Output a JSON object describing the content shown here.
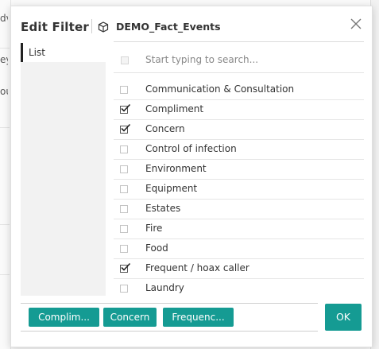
{
  "dialog": {
    "title": "Edit Filter",
    "table_name": "DEMO_Fact_Events",
    "ok_label": "OK"
  },
  "nav": {
    "items": [
      {
        "label": "List",
        "active": true
      }
    ]
  },
  "search": {
    "placeholder": "Start typing to search..."
  },
  "items": [
    {
      "label": "Communication & Consultation",
      "checked": false
    },
    {
      "label": "Compliment",
      "checked": true
    },
    {
      "label": "Concern",
      "checked": true
    },
    {
      "label": "Control of infection",
      "checked": false
    },
    {
      "label": "Environment",
      "checked": false
    },
    {
      "label": "Equipment",
      "checked": false
    },
    {
      "label": "Estates",
      "checked": false
    },
    {
      "label": "Fire",
      "checked": false
    },
    {
      "label": "Food",
      "checked": false
    },
    {
      "label": "Frequent / hoax caller",
      "checked": true
    },
    {
      "label": "Laundry",
      "checked": false
    }
  ],
  "selected_chips": [
    "Complim...",
    "Concern",
    "Frequenc..."
  ],
  "background_fragments": [
    "dv",
    "ey",
    "ou"
  ],
  "colors": {
    "accent": "#159b93",
    "nav_active_border": "#222222"
  },
  "icons": {
    "close": "close-icon",
    "table": "cube-icon",
    "check": "checkmark-icon"
  }
}
